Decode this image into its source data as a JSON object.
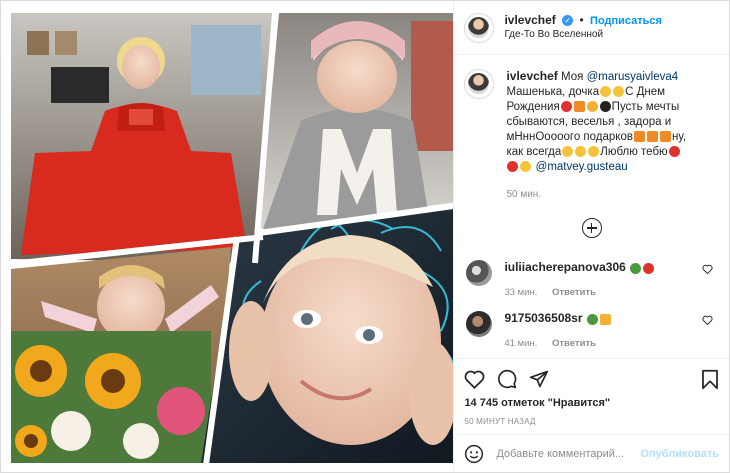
{
  "header": {
    "username": "ivlevchef",
    "follow_label": "Подписаться",
    "location": "Где-То Во Вселенной",
    "separator": "•"
  },
  "caption": {
    "username": "ivlevchef",
    "word_1": "Моя",
    "mention_1": "@marusyaivleva4",
    "line_2": "Машенька, дочка",
    "line_2b": "С Днем",
    "line_3": "Рождения",
    "line_3b": "Пусть мечты",
    "line_4": "сбываются, веселья , задора и",
    "line_5": "мНннОоооого подарков",
    "line_5b": "ну,",
    "line_6": "как всегда",
    "line_6b": "Люблю тебю",
    "mention_2": "@matvey.gusteau",
    "time": "50 мин."
  },
  "comments": [
    {
      "username": "iuliiacherepanova306",
      "time": "33 мин.",
      "reply": "Ответить"
    },
    {
      "username": "9175036508sr",
      "time": "41 мин.",
      "reply": "Ответить"
    }
  ],
  "likes": "14 745 отметок \"Нравится\"",
  "posted": "50 МИНУТ НАЗАД",
  "add_comment": {
    "placeholder": "Добавьте комментарий...",
    "publish_label": "Опубликовать"
  },
  "icons": {
    "verified": "verified-badge-icon",
    "like": "heart-icon",
    "comment": "comment-icon",
    "share": "paper-plane-icon",
    "save": "bookmark-icon",
    "emoji": "smiley-icon",
    "load_more": "plus-circle-icon"
  },
  "colors": {
    "accent": "#0095f6",
    "verified": "#3897f0",
    "muted": "#8e8e8e",
    "heart_red": "#ed4956"
  }
}
